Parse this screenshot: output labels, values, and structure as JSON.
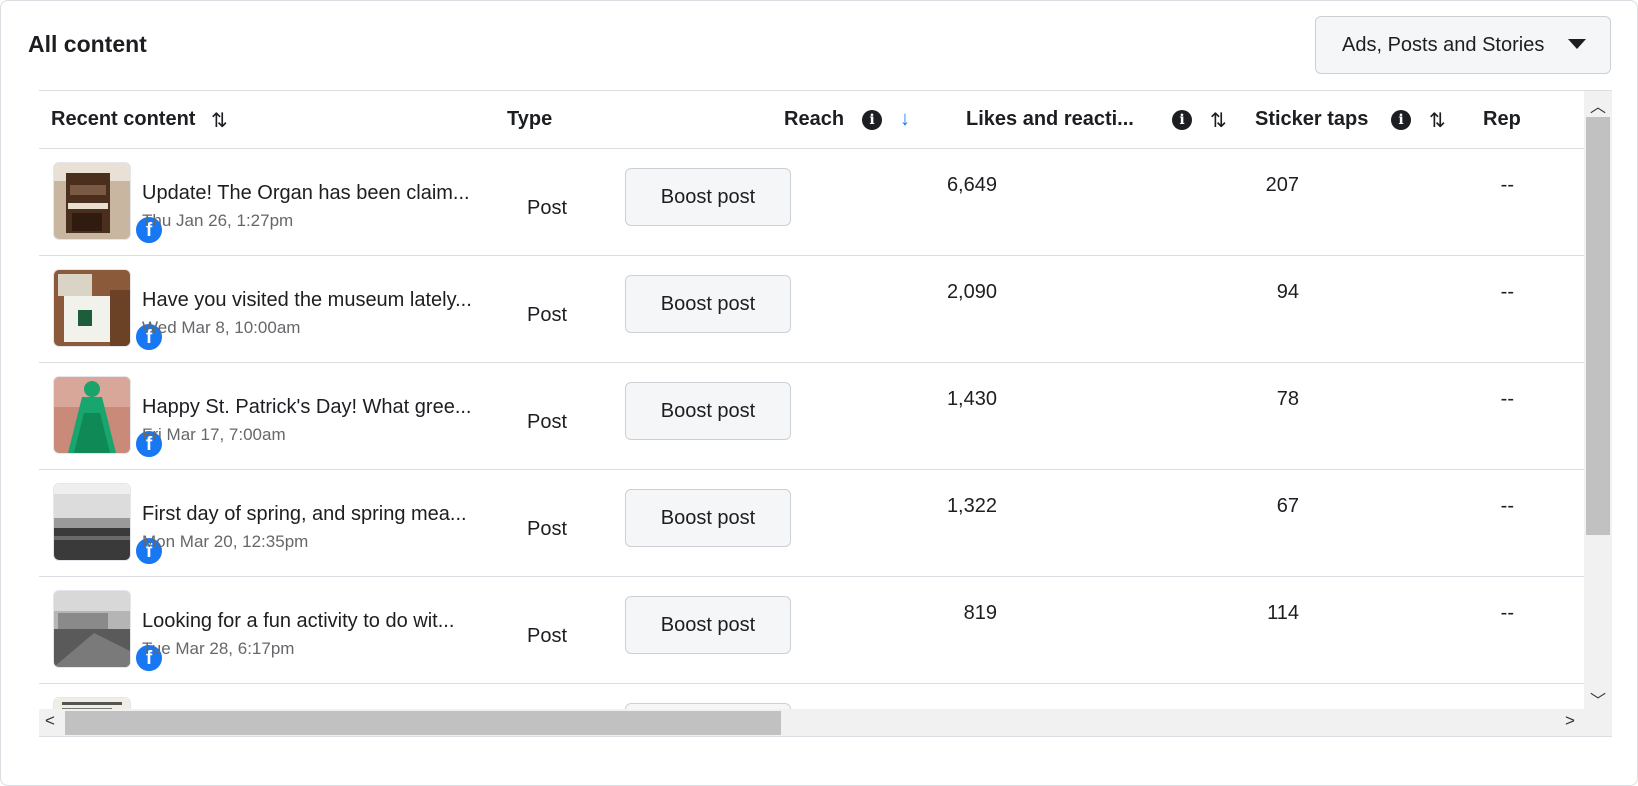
{
  "header": {
    "title": "All content",
    "filter_label": "Ads, Posts and Stories"
  },
  "columns": {
    "recent_content": "Recent content",
    "type": "Type",
    "reach": "Reach",
    "likes": "Likes and reacti...",
    "stickers": "Sticker taps",
    "rep": "Rep"
  },
  "rows": [
    {
      "title": "Update! The Organ has been claim...",
      "date": "Thu Jan 26, 1:27pm",
      "type": "Post",
      "boost": "Boost post",
      "reach": "6,649",
      "likes": "207",
      "stickers": "--"
    },
    {
      "title": "Have you visited the museum lately...",
      "date": "Wed Mar 8, 10:00am",
      "type": "Post",
      "boost": "Boost post",
      "reach": "2,090",
      "likes": "94",
      "stickers": "--"
    },
    {
      "title": "Happy St. Patrick's Day! What gree...",
      "date": "Fri Mar 17, 7:00am",
      "type": "Post",
      "boost": "Boost post",
      "reach": "1,430",
      "likes": "78",
      "stickers": "--"
    },
    {
      "title": "First day of spring, and spring mea...",
      "date": "Mon Mar 20, 12:35pm",
      "type": "Post",
      "boost": "Boost post",
      "reach": "1,322",
      "likes": "67",
      "stickers": "--"
    },
    {
      "title": "Looking for a fun activity to do wit...",
      "date": "Tue Mar 28, 6:17pm",
      "type": "Post",
      "boost": "Boost post",
      "reach": "819",
      "likes": "114",
      "stickers": "--"
    }
  ],
  "icons": {
    "sort": "sort-icon",
    "sort_desc": "arrow-down-icon",
    "info": "info-icon",
    "platform": "facebook-icon",
    "filter_caret": "caret-down-icon"
  },
  "colors": {
    "accent": "#1877f2",
    "border": "#dadde1"
  }
}
